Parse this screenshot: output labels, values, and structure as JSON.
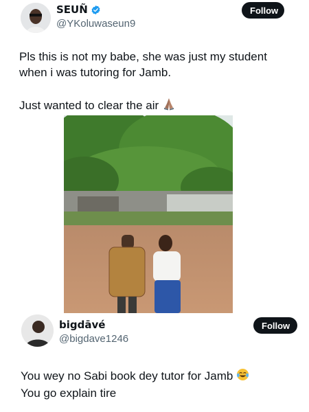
{
  "tweet": {
    "author": {
      "display_name": "SEUÑ",
      "handle": "@YKoluwaseun9",
      "verified": true
    },
    "follow_label": "Follow",
    "text_line1": "Pls this is not my babe, she was just my student when i was tutoring for Jamb.",
    "text_line2": "Just wanted to clear the air",
    "text_line2_emoji": "folded-hands-emoji"
  },
  "reply": {
    "author": {
      "display_name": "bigdāvé",
      "handle": "@bigdave1246"
    },
    "follow_label": "Follow",
    "text_line1": "You wey no Sabi book dey tutor for Jamb",
    "text_line1_emoji": "laughing-tears-emoji",
    "text_line2": "You go explain tire"
  },
  "colors": {
    "text": "#0f1419",
    "muted": "#536471",
    "button": "#0f1419",
    "verified": "#1d9bf0"
  }
}
